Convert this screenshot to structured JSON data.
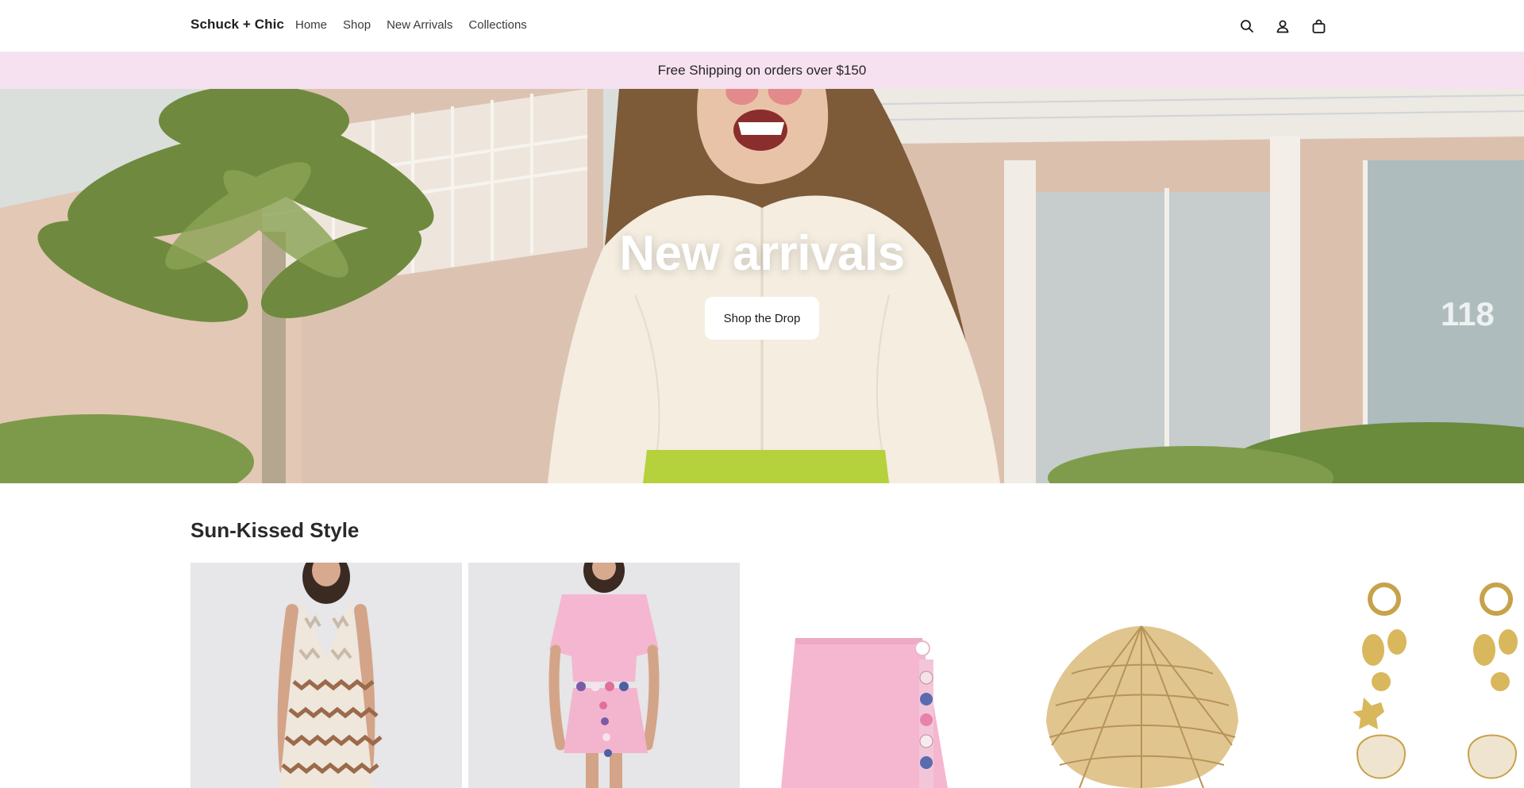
{
  "header": {
    "brand": "Schuck + Chic",
    "nav": [
      {
        "label": "Home"
      },
      {
        "label": "Shop"
      },
      {
        "label": "New Arrivals"
      },
      {
        "label": "Collections"
      }
    ],
    "icons": [
      "search-icon",
      "account-icon",
      "cart-icon"
    ]
  },
  "announcement": {
    "text": "Free Shipping on orders over $150",
    "background": "#f6e1f0"
  },
  "hero": {
    "title": "New arrivals",
    "cta_label": "Shop the Drop",
    "room_number": "118"
  },
  "collection": {
    "title": "Sun-Kissed Style",
    "products": [
      {
        "image": "zigzag-halter-romper"
      },
      {
        "image": "pink-top-and-floral-skirt-set"
      },
      {
        "image": "pink-floral-wrap-skirt"
      },
      {
        "image": "woven-rattan-shell-clutch"
      },
      {
        "image": "gold-seashell-drop-earrings"
      }
    ]
  }
}
